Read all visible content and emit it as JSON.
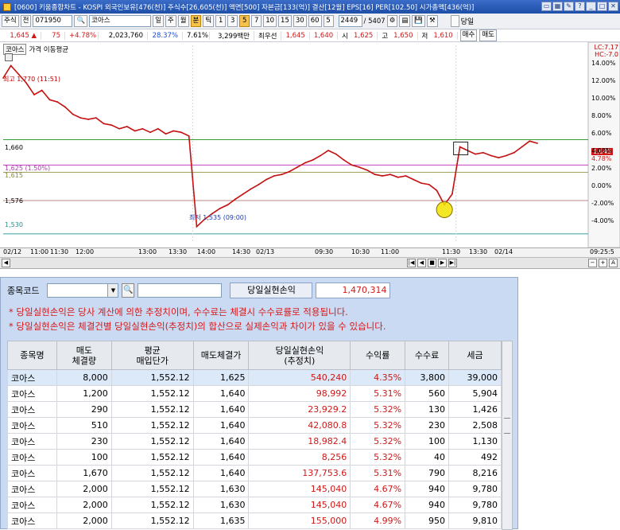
{
  "window": {
    "title": "[0600] 키움종합차트 - KOSPI 외국인보유[476(천)] 주식수[26,605(천)] 액면[500] 자본금[133(억)] 결산[12월] EPS[16] PER[102.50] 시가총액[436(억)]"
  },
  "toolbar": {
    "market": "주식",
    "period_mode": "전",
    "code": "071950",
    "stock_name": "코아스",
    "chart_types": [
      "일",
      "주",
      "월",
      "분",
      "틱"
    ],
    "intervals": [
      "1",
      "3",
      "5",
      "7",
      "10",
      "15",
      "30",
      "60",
      "5"
    ],
    "count": "2449",
    "count_total": "/ 5407",
    "today_label": "당일"
  },
  "quote": {
    "price": "1,645 ▲",
    "change": "75",
    "change_pct": "+4.78%",
    "volume": "2,023,760",
    "volume_ratio": "28.37%",
    "turnover": "7.61%",
    "amount": "3,299백만",
    "pref": "최우선",
    "ask": "1,645",
    "bid": "1,640",
    "open_label": "시",
    "open": "1,625",
    "high_label": "고",
    "high": "1,650",
    "low_label": "저",
    "low": "1,610",
    "buy_label": "매수",
    "sell_label": "매도"
  },
  "chart": {
    "tag1": "코아스",
    "tag2": "가격 이동평균",
    "lc_label": "LC:7.17",
    "hc_label": "HC:-7.0",
    "high_note": "최고 1,770 (11:51)",
    "low_note": "최저 1,535 (09:00)",
    "price_levels": [
      "1,660",
      "1,625 (1.50%)",
      "1,615",
      "1,576",
      "1,530"
    ],
    "current_price_tag": "1,645",
    "current_pct_tag": "4.78%",
    "pct_ticks": [
      "14.00%",
      "12.00%",
      "10.00%",
      "8.00%",
      "6.00%",
      "4.00%",
      "2.00%",
      "0.00%",
      "-2.00%",
      "-4.00%"
    ],
    "time_ticks": [
      "02/12",
      "11:00",
      "11:30",
      "12:00",
      "13:00",
      "13:30",
      "14:00",
      "14:30",
      "02/13",
      "09:30",
      "10:30",
      "11:00",
      "11:30",
      "13:30",
      "02/14",
      "09:25:5"
    ]
  },
  "chart_data": {
    "type": "line",
    "title": "",
    "xlabel": "",
    "ylabel": "",
    "ylim": [
      1520,
      1790
    ],
    "series": [
      {
        "values": [
          1745,
          1762,
          1750,
          1738,
          1722,
          1728,
          1715,
          1712,
          1705,
          1695,
          1690,
          1688,
          1690,
          1682,
          1680,
          1675,
          1678,
          1672,
          1675,
          1670,
          1675,
          1668,
          1672,
          1670,
          1665,
          1540,
          1550,
          1558,
          1565,
          1570,
          1578,
          1585,
          1592,
          1598,
          1605,
          1610,
          1612,
          1616,
          1622,
          1628,
          1632,
          1638,
          1645,
          1640,
          1632,
          1625,
          1622,
          1618,
          1612,
          1610,
          1612,
          1608,
          1610,
          1605,
          1600,
          1598,
          1590,
          1570,
          1585,
          1650,
          1645,
          1640,
          1642,
          1638,
          1635,
          1638,
          1642,
          1650,
          1658,
          1655
        ]
      }
    ]
  },
  "panel": {
    "code_label": "종목코드",
    "realized_label": "당일실현손익",
    "realized_value": "1,470,314",
    "notes": [
      "* 당일실현손익은 당사 계산에 의한 추정치이며, 수수료는 체결시 수수료률로 적용됩니다.",
      "* 당일실현손익은 체결건별 당일실현손익(추정치)의 합산으로 실제손익과 차이가 있을 수 있습니다."
    ],
    "headers": [
      {
        "l1": "종목명",
        "l2": ""
      },
      {
        "l1": "매도",
        "l2": "체결량"
      },
      {
        "l1": "평균",
        "l2": "매입단가"
      },
      {
        "l1": "매도체결가",
        "l2": ""
      },
      {
        "l1": "당일실현손익",
        "l2": "(추정치)"
      },
      {
        "l1": "수익률",
        "l2": ""
      },
      {
        "l1": "수수료",
        "l2": ""
      },
      {
        "l1": "세금",
        "l2": ""
      }
    ],
    "rows": [
      [
        "코아스",
        "8,000",
        "1,552.12",
        "1,625",
        "540,240",
        "4.35%",
        "3,800",
        "39,000"
      ],
      [
        "코아스",
        "1,200",
        "1,552.12",
        "1,640",
        "98,992",
        "5.31%",
        "560",
        "5,904"
      ],
      [
        "코아스",
        "290",
        "1,552.12",
        "1,640",
        "23,929.2",
        "5.32%",
        "130",
        "1,426"
      ],
      [
        "코아스",
        "510",
        "1,552.12",
        "1,640",
        "42,080.8",
        "5.32%",
        "230",
        "2,508"
      ],
      [
        "코아스",
        "230",
        "1,552.12",
        "1,640",
        "18,982.4",
        "5.32%",
        "100",
        "1,130"
      ],
      [
        "코아스",
        "100",
        "1,552.12",
        "1,640",
        "8,256",
        "5.32%",
        "40",
        "492"
      ],
      [
        "코아스",
        "1,670",
        "1,552.12",
        "1,640",
        "137,753.6",
        "5.31%",
        "790",
        "8,216"
      ],
      [
        "코아스",
        "2,000",
        "1,552.12",
        "1,630",
        "145,040",
        "4.67%",
        "940",
        "9,780"
      ],
      [
        "코아스",
        "2,000",
        "1,552.12",
        "1,630",
        "145,040",
        "4.67%",
        "940",
        "9,780"
      ],
      [
        "코아스",
        "2,000",
        "1,552.12",
        "1,635",
        "155,000",
        "4.99%",
        "950",
        "9,810"
      ]
    ]
  }
}
